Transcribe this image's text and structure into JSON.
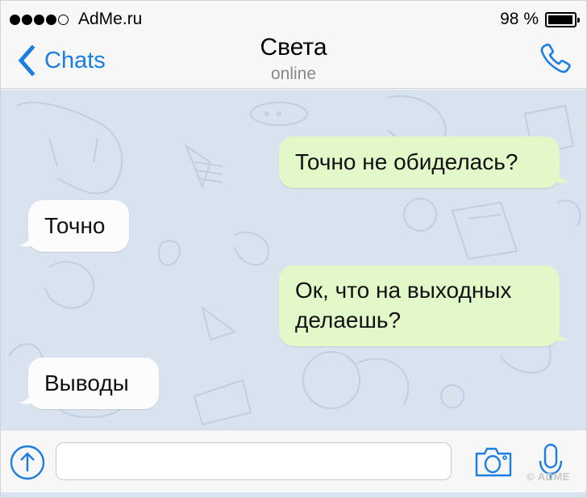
{
  "status_bar": {
    "signal_bars_filled": 4,
    "signal_bars_total": 5,
    "carrier": "AdMe.ru",
    "battery_percent_label": "98 %",
    "battery_level": 0.98
  },
  "nav": {
    "back_label": "Chats",
    "back_icon": "chevron-left-icon",
    "title": "Света",
    "subtitle": "online",
    "call_icon": "phone-icon"
  },
  "colors": {
    "accent": "#1a7de1",
    "outgoing_bubble": "#e2f8c9",
    "incoming_bubble": "#fcfcfc",
    "chat_background": "#d9e3ef"
  },
  "messages": [
    {
      "direction": "outgoing",
      "text": "Точно не обиделась?"
    },
    {
      "direction": "incoming",
      "text": "Точно"
    },
    {
      "direction": "outgoing",
      "text": "Ок, что на выходных делаешь?"
    },
    {
      "direction": "incoming",
      "text": "Выводы"
    }
  ],
  "composer": {
    "attach_icon": "arrow-up-circle-icon",
    "input_value": "",
    "camera_icon": "camera-icon",
    "mic_icon": "microphone-icon"
  },
  "watermark": "© ADME"
}
